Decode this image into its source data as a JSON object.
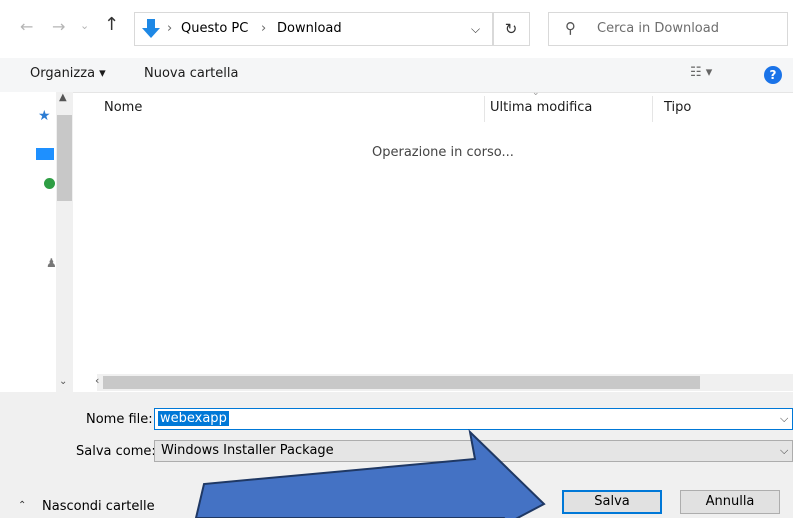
{
  "addressbar": {
    "breadcrumbs": [
      "Questo PC",
      "Download"
    ],
    "search_placeholder": "Cerca in Download"
  },
  "toolbar": {
    "organize_label": "Organizza ▾",
    "new_folder_label": "Nuova cartella",
    "help_label": "?"
  },
  "filelist": {
    "columns": [
      "Nome",
      "Ultima modifica",
      "Tipo"
    ],
    "status": "Operazione in corso..."
  },
  "form": {
    "filename_label": "Nome file:",
    "filename_value": "webexapp",
    "savetype_label": "Salva come:",
    "savetype_value": "Windows Installer Package"
  },
  "footer": {
    "hide_folders_label": "Nascondi cartelle",
    "save_label": "Salva",
    "cancel_label": "Annulla"
  },
  "colors": {
    "accent": "#0078d7",
    "arrow_fill": "#4472c4",
    "arrow_stroke": "#1f3864"
  },
  "icons": [
    "back-arrow-icon",
    "forward-arrow-icon",
    "recent-dropdown-icon",
    "up-arrow-icon",
    "download-folder-icon",
    "refresh-icon",
    "search-icon",
    "view-icon",
    "help-icon",
    "quick-access-star-icon",
    "desktop-icon",
    "onedrive-icon",
    "user-icon"
  ]
}
